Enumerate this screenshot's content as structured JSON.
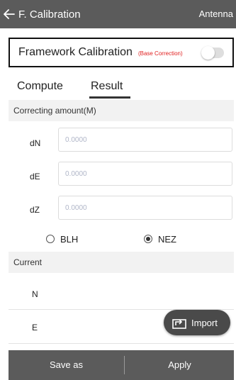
{
  "appbar": {
    "title": "F. Calibration",
    "action": "Antenna"
  },
  "framework": {
    "title": "Framework Calibration",
    "subtitle": "(Base Correction)",
    "toggle_on": false
  },
  "tabs": [
    {
      "label": "Compute",
      "active": false
    },
    {
      "label": "Result",
      "active": true
    }
  ],
  "correcting": {
    "header": "Correcting amount(M)",
    "rows": [
      {
        "label": "dN",
        "placeholder": "0.0000"
      },
      {
        "label": "dE",
        "placeholder": "0.0000"
      },
      {
        "label": "dZ",
        "placeholder": "0.0000"
      }
    ]
  },
  "coord_system": {
    "options": [
      "BLH",
      "NEZ"
    ],
    "selected": "NEZ"
  },
  "current": {
    "header": "Current",
    "rows": [
      {
        "label": "N"
      },
      {
        "label": "E"
      }
    ]
  },
  "import_button": {
    "label": "Import",
    "icon": "import-icon"
  },
  "bottom": {
    "save_label": "Save as",
    "apply_label": "Apply"
  },
  "colors": {
    "appbar": "#5b5b5b",
    "accent_red": "#e02020",
    "section_bg": "#f2f2f2"
  }
}
